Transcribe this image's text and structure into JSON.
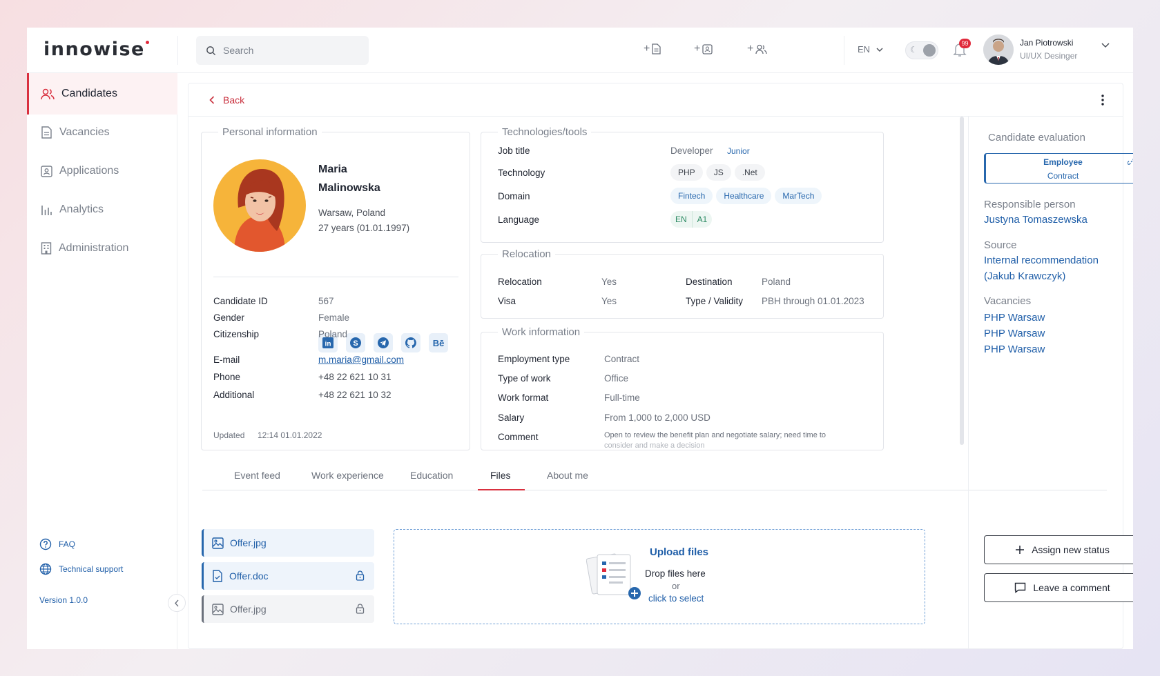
{
  "header": {
    "logo": "innowise",
    "search_placeholder": "Search",
    "language": "EN",
    "notifications_count": "99",
    "user_name": "Jan Piotrowski",
    "user_role": "UI/UX Desinger"
  },
  "sidebar": {
    "items": [
      {
        "label": "Candidates",
        "icon": "users-icon"
      },
      {
        "label": "Vacancies",
        "icon": "document-icon"
      },
      {
        "label": "Applications",
        "icon": "badge-icon"
      },
      {
        "label": "Analytics",
        "icon": "bar-chart-icon"
      },
      {
        "label": "Administration",
        "icon": "building-icon"
      }
    ],
    "faq": "FAQ",
    "support": "Technical support",
    "version": "Version 1.0.0"
  },
  "back_label": "Back",
  "personal": {
    "legend": "Personal information",
    "first_name": "Maria",
    "last_name": "Malinowska",
    "location": "Warsaw, Poland",
    "age": "27 years (01.01.1997)",
    "socials": [
      "in",
      "S",
      "tg",
      "gh",
      "Bē"
    ],
    "candidate_id_label": "Candidate ID",
    "candidate_id": "567",
    "gender_label": "Gender",
    "gender": "Female",
    "citizenship_label": "Citizenship",
    "citizenship": "Poland",
    "email_label": "E-mail",
    "email": "m.maria@gmail.com",
    "phone_label": "Phone",
    "phone": "+48 22 621 10 31",
    "additional_label": "Additional",
    "additional": "+48 22 621 10 32",
    "updated_label": "Updated",
    "updated": "12:14 01.01.2022"
  },
  "tech": {
    "legend": "Technologies/tools",
    "job_title_label": "Job title",
    "job_title": "Developer",
    "level": "Junior",
    "technology_label": "Technology",
    "technologies": [
      "PHP",
      "JS",
      ".Net"
    ],
    "domain_label": "Domain",
    "domains": [
      "Fintech",
      "Healthcare",
      "MarTech"
    ],
    "language_label": "Language",
    "language": "EN",
    "language_level": "A1"
  },
  "relocation": {
    "legend": "Relocation",
    "relocation_label": "Relocation",
    "relocation": "Yes",
    "visa_label": "Visa",
    "visa": "Yes",
    "destination_label": "Destination",
    "destination": "Poland",
    "type_label": "Type / Validity",
    "type": "PBH through 01.01.2023"
  },
  "work": {
    "legend": "Work information",
    "employment_label": "Employment type",
    "employment": "Contract",
    "type_label": "Type of work",
    "type": "Office",
    "format_label": "Work format",
    "format": "Full-time",
    "salary_label": "Salary",
    "salary": "From 1,000 to 2,000 USD",
    "comment_label": "Comment",
    "comment_line1": "Open to review the benefit plan and negotiate salary; need time to",
    "comment_line2": "consider and make a decision"
  },
  "tabs": [
    "Event feed",
    "Work experience",
    "Education",
    "Files",
    "About me"
  ],
  "active_tab": "Files",
  "files": [
    {
      "name": "Offer.jpg",
      "locked": false
    },
    {
      "name": "Offer.doc",
      "locked": true
    },
    {
      "name": "Offer.jpg",
      "locked": true
    }
  ],
  "upload": {
    "title": "Upload files",
    "drop": "Drop files here",
    "or": "or",
    "click": "click to select"
  },
  "evaluation": {
    "heading": "Candidate evaluation",
    "status_line1": "Employee",
    "status_line2": "Contract",
    "responsible_label": "Responsible person",
    "responsible": "Justyna Tomaszewska",
    "source_label": "Source",
    "source_line1": "Internal recommendation",
    "source_line2": "(Jakub Krawczyk)",
    "vacancies_label": "Vacancies",
    "vacancies": [
      "PHP Warsaw",
      "PHP Warsaw",
      "PHP Warsaw"
    ],
    "assign_label": "Assign new status",
    "comment_label": "Leave a comment"
  },
  "colors": {
    "accent": "#d9303f",
    "link": "#1f5ea8",
    "brand_blue": "#2767ad"
  }
}
